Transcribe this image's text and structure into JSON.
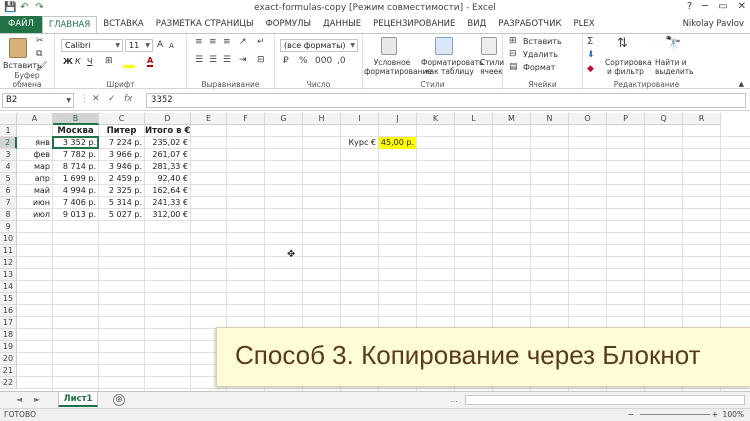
{
  "window": {
    "title": "exact-formulas-copy [Режим совместимости] - Excel",
    "user": "Nikolay Pavlov",
    "help": "?",
    "minimize": "─",
    "restore": "▭",
    "close": "✕"
  },
  "quick_access": {
    "save": "💾",
    "undo": "↶",
    "redo": "↷"
  },
  "ribbon_tabs": [
    "ФАЙЛ",
    "ГЛАВНАЯ",
    "ВСТАВКА",
    "РАЗМЕТКА СТРАНИЦЫ",
    "ФОРМУЛЫ",
    "ДАННЫЕ",
    "РЕЦЕНЗИРОВАНИЕ",
    "ВИД",
    "РАЗРАБОТЧИК",
    "PLEX"
  ],
  "ribbon": {
    "clipboard": {
      "label": "Буфер обмена",
      "paste": "Вставить"
    },
    "font": {
      "label": "Шрифт",
      "name": "Calibri",
      "size": "11",
      "bold": "Ж",
      "italic": "К",
      "underline": "Ч",
      "grow": "A",
      "shrink": "A"
    },
    "alignment": {
      "label": "Выравнивание"
    },
    "number": {
      "label": "Число",
      "format": "(все форматы)"
    },
    "styles": {
      "label": "Стили",
      "conditional_l1": "Условное",
      "conditional_l2": "форматирование",
      "table_l1": "Форматировать",
      "table_l2": "как таблицу",
      "cell_l1": "Стили",
      "cell_l2": "ячеек"
    },
    "cells": {
      "label": "Ячейки",
      "insert": "Вставить",
      "delete": "Удалить",
      "format": "Формат"
    },
    "editing": {
      "label": "Редактирование",
      "sort_l1": "Сортировка",
      "sort_l2": "и фильтр",
      "find_l1": "Найти и",
      "find_l2": "выделить"
    }
  },
  "formula_bar": {
    "name_box": "B2",
    "cancel": "✕",
    "enter": "✓",
    "fx": "fx",
    "content": "3352"
  },
  "columns": [
    "A",
    "B",
    "C",
    "D",
    "E",
    "F",
    "G",
    "H",
    "I",
    "J",
    "K",
    "L",
    "M",
    "N",
    "O",
    "P",
    "Q",
    "R"
  ],
  "rows": [
    "1",
    "2",
    "3",
    "4",
    "5",
    "6",
    "7",
    "8",
    "9",
    "10",
    "11",
    "12",
    "13",
    "14",
    "15",
    "16",
    "17",
    "18",
    "19",
    "20",
    "21",
    "22"
  ],
  "cells": {
    "headers": {
      "B": "Москва",
      "C": "Питер",
      "D": "Итого в €"
    },
    "months": [
      "янв",
      "фев",
      "мар",
      "апр",
      "май",
      "июн",
      "июл"
    ],
    "moscow": [
      "3 352 р.",
      "7 782 р.",
      "8 714 р.",
      "1 699 р.",
      "4 994 р.",
      "7 406 р.",
      "9 013 р."
    ],
    "piter": [
      "7 224 р.",
      "3 966 р.",
      "3 946 р.",
      "2 459 р.",
      "2 325 р.",
      "5 314 р.",
      "5 027 р."
    ],
    "total": [
      "235,02 €",
      "261,07 €",
      "281,33 €",
      "92,40 €",
      "162,64 €",
      "241,33 €",
      "312,00 €"
    ],
    "rate_label": "Курс €",
    "rate_value": "45,00 р."
  },
  "sheets": {
    "active": "Лист1",
    "add": "⊕",
    "prev": "◄",
    "next": "►",
    "more": "…"
  },
  "status": {
    "mode": "ГОТОВО",
    "zoom": "100%",
    "zoom_minus": "−",
    "zoom_plus": "+"
  },
  "banner": {
    "text": "Способ 3. Копирование через Блокнот"
  }
}
